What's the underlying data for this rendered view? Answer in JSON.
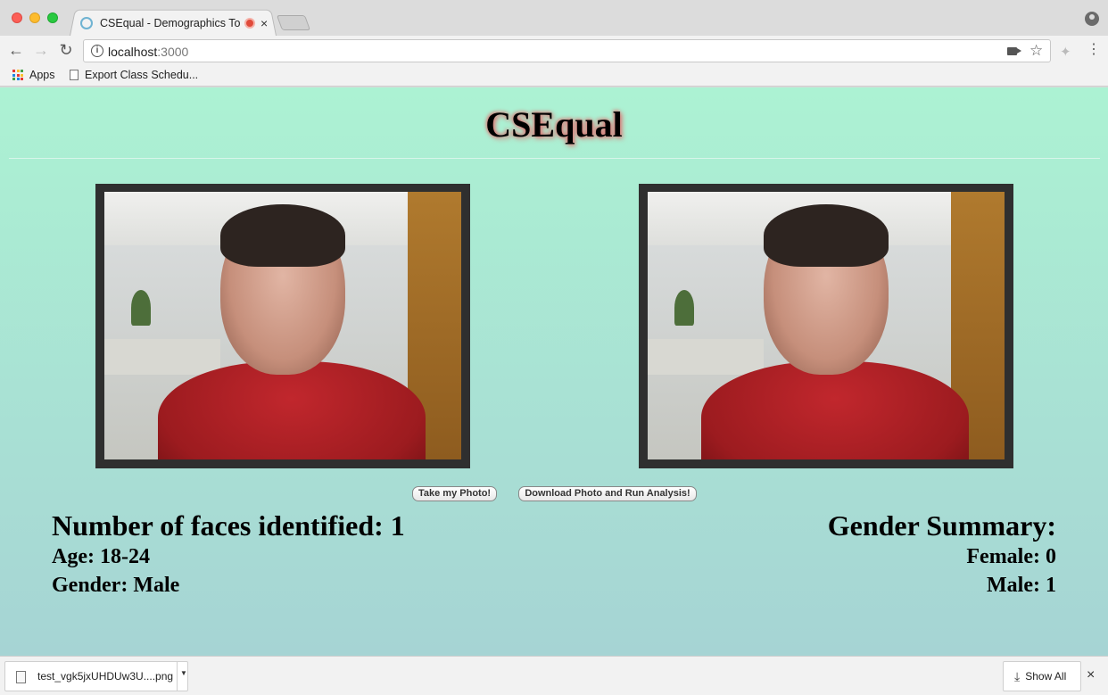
{
  "browser": {
    "tab_title": "CSEqual - Demographics To",
    "tab_close": "×",
    "url_host": "localhost",
    "url_port": ":3000",
    "bookmarks": [
      {
        "label": "Apps"
      },
      {
        "label": "Export Class Schedu..."
      }
    ]
  },
  "page": {
    "title": "CSEqual",
    "buttons": {
      "take_photo": "Take my Photo!",
      "run_analysis": "Download Photo and Run Analysis!"
    },
    "faces": {
      "count_label": "Number of faces identified: 1",
      "age": "Age: 18-24",
      "gender": "Gender: Male"
    },
    "gender_summary": {
      "heading": "Gender Summary:",
      "female": "Female: 0",
      "male": "Male: 1"
    }
  },
  "downloads": {
    "file_name": "test_vgk5jxUHDUw3U....png",
    "show_all": "Show All",
    "close": "×"
  },
  "colors": {
    "page_gradient_top": "#acf2d3",
    "page_gradient_bottom": "#a6d4d4",
    "title_glow": "#e07070",
    "frame": "#2f2f2f"
  },
  "icons": [
    "back-arrow-icon",
    "forward-arrow-icon",
    "reload-icon",
    "info-icon",
    "camera-icon",
    "star-icon",
    "extension-icon",
    "menu-icon",
    "apps-icon",
    "document-icon",
    "download-icon",
    "profile-icon"
  ]
}
